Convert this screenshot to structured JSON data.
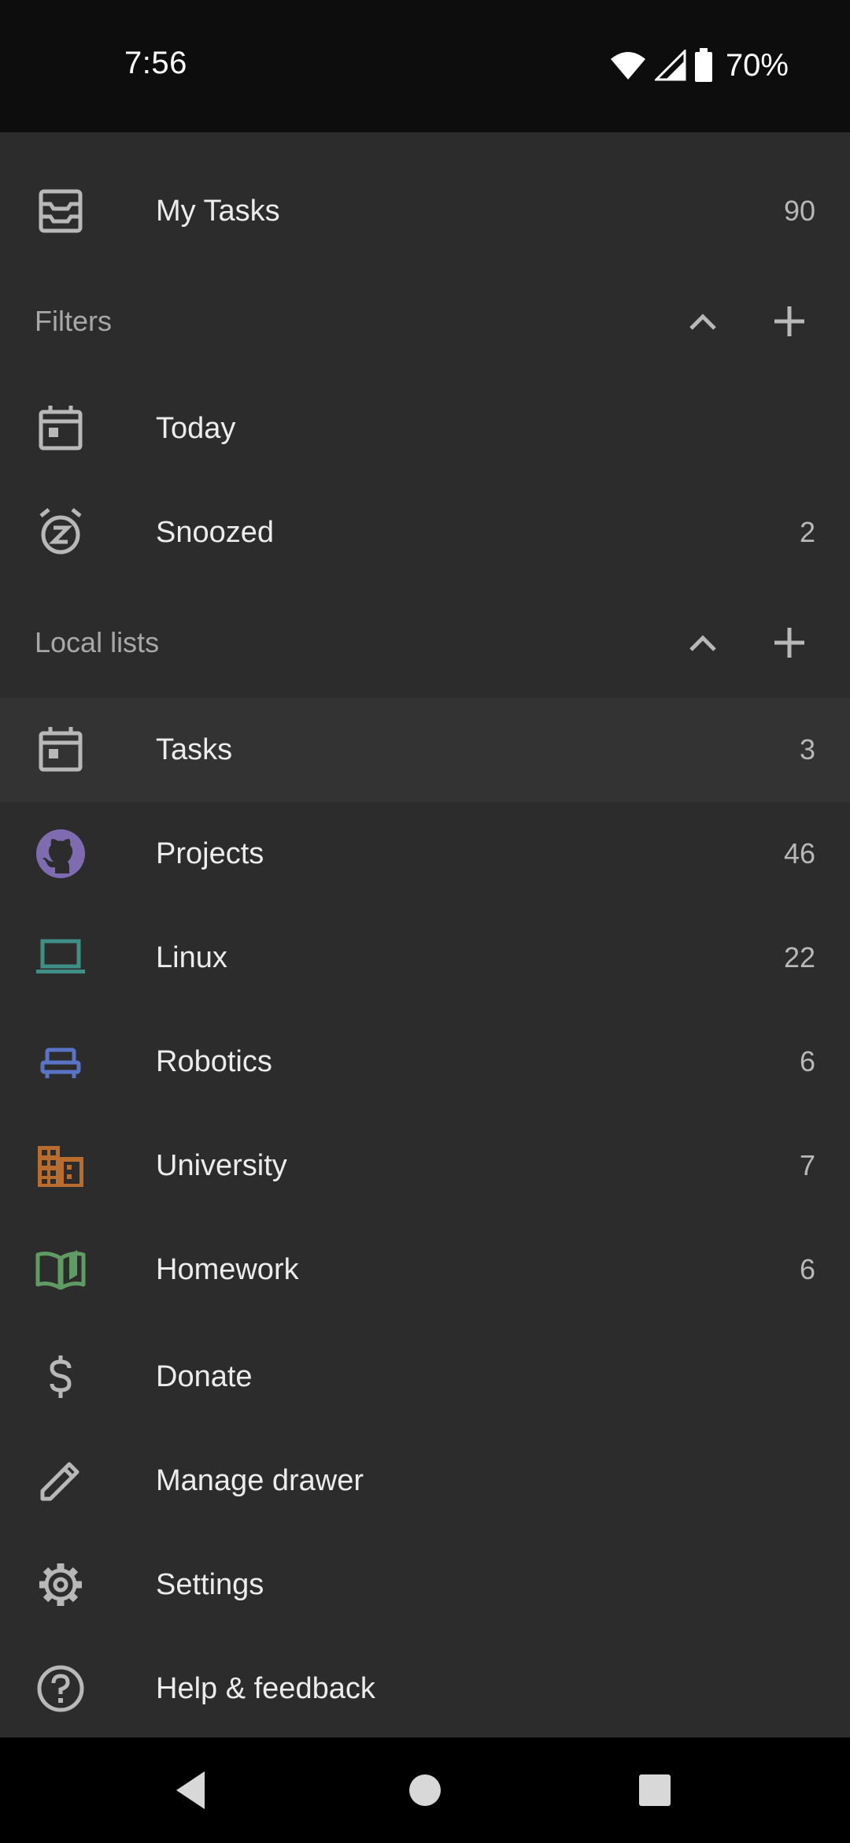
{
  "status_bar": {
    "time": "7:56",
    "battery": "70%"
  },
  "drawer": {
    "my_tasks": {
      "label": "My Tasks",
      "count": "90",
      "icon": "inbox-icon"
    },
    "filters": {
      "title": "Filters",
      "items": [
        {
          "label": "Today",
          "count": "",
          "icon": "calendar-today-icon"
        },
        {
          "label": "Snoozed",
          "count": "2",
          "icon": "snooze-alarm-icon"
        }
      ]
    },
    "local_lists": {
      "title": "Local lists",
      "items": [
        {
          "label": "Tasks",
          "count": "3",
          "icon": "calendar-today-icon"
        },
        {
          "label": "Projects",
          "count": "46",
          "icon": "github-icon",
          "color": "#7e6bb0"
        },
        {
          "label": "Linux",
          "count": "22",
          "icon": "laptop-icon",
          "color": "#3f8f86"
        },
        {
          "label": "Robotics",
          "count": "6",
          "icon": "robot-icon",
          "color": "#5a73c4"
        },
        {
          "label": "University",
          "count": "7",
          "icon": "building-icon",
          "color": "#b86d2f"
        },
        {
          "label": "Homework",
          "count": "6",
          "icon": "open-book-icon",
          "color": "#5f9c64"
        }
      ]
    },
    "footer_items": [
      {
        "label": "Donate",
        "icon": "dollar-icon"
      },
      {
        "label": "Manage drawer",
        "icon": "pencil-icon"
      },
      {
        "label": "Settings",
        "icon": "gear-icon"
      },
      {
        "label": "Help & feedback",
        "icon": "help-icon"
      }
    ]
  },
  "colors": {
    "background": "#2c2c2c",
    "selected_row": "#333333",
    "icon_default": "#b8b8b8",
    "status_bar": "#0d0d0d",
    "nav_bar": "#000000"
  }
}
